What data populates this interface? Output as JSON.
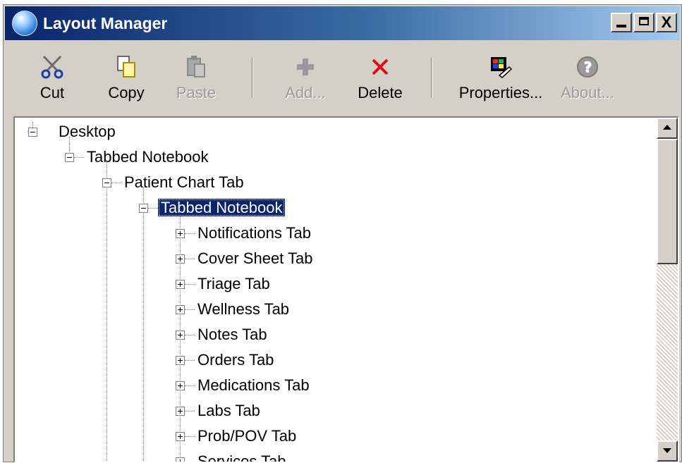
{
  "window": {
    "title": "Layout Manager",
    "controls": {
      "minimize": "_",
      "maximize": "□",
      "close": "X"
    }
  },
  "toolbar": {
    "cut": {
      "label": "Cut",
      "icon": "scissors-icon",
      "enabled": true
    },
    "copy": {
      "label": "Copy",
      "icon": "copy-icon",
      "enabled": true
    },
    "paste": {
      "label": "Paste",
      "icon": "paste-icon",
      "enabled": false
    },
    "add": {
      "label": "Add...",
      "icon": "plus-icon",
      "enabled": false
    },
    "delete": {
      "label": "Delete",
      "icon": "delete-x-icon",
      "enabled": true
    },
    "properties": {
      "label": "Properties...",
      "icon": "properties-icon",
      "enabled": true
    },
    "about": {
      "label": "About...",
      "icon": "help-icon",
      "enabled": false
    }
  },
  "tree": {
    "root": {
      "label": "Desktop",
      "expanded": true
    },
    "notebook": {
      "label": "Tabbed Notebook",
      "expanded": true
    },
    "chart_tab": {
      "label": "Patient Chart Tab",
      "expanded": true
    },
    "inner_notebook": {
      "label": "Tabbed Notebook",
      "expanded": true,
      "selected": true
    },
    "tabs": [
      {
        "label": "Notifications Tab",
        "expanded": false
      },
      {
        "label": "Cover Sheet Tab",
        "expanded": false
      },
      {
        "label": "Triage Tab",
        "expanded": false
      },
      {
        "label": "Wellness Tab",
        "expanded": false
      },
      {
        "label": "Notes Tab",
        "expanded": false
      },
      {
        "label": "Orders Tab",
        "expanded": false
      },
      {
        "label": "Medications Tab",
        "expanded": false
      },
      {
        "label": "Labs Tab",
        "expanded": false
      },
      {
        "label": "Prob/POV Tab",
        "expanded": false
      },
      {
        "label": "Services Tab",
        "expanded": false
      }
    ]
  },
  "colors": {
    "selection": "#0a246a",
    "title_gradient_start": "#0a246a",
    "title_gradient_end": "#a6caf0",
    "face": "#d4d0c8"
  }
}
